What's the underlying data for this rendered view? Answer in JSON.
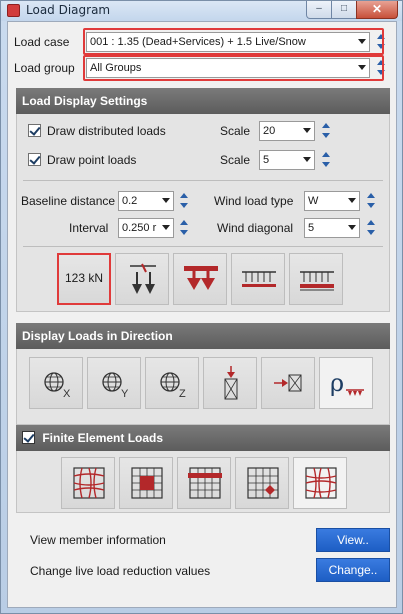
{
  "window": {
    "title": "Load Diagram",
    "controls": {
      "minimize": "–",
      "maximize": "□",
      "close": "✕"
    }
  },
  "load_case": {
    "label": "Load case",
    "value": "001 : 1.35 (Dead+Services) + 1.5 Live/Snow"
  },
  "load_group": {
    "label": "Load group",
    "value": "All Groups"
  },
  "display_settings": {
    "header": "Load Display Settings",
    "draw_distributed": {
      "label": "Draw distributed loads",
      "checked": true
    },
    "draw_point": {
      "label": "Draw point loads",
      "checked": true
    },
    "scale_label_1": "Scale",
    "scale_value_1": "20",
    "scale_label_2": "Scale",
    "scale_value_2": "5",
    "baseline_label": "Baseline distance",
    "baseline_value": "0.2",
    "interval_label": "Interval",
    "interval_value": "0.250 r",
    "wind_type_label": "Wind load type",
    "wind_type_value": "W",
    "wind_diag_label": "Wind diagonal",
    "wind_diag_value": "5",
    "buttons": [
      {
        "name": "show-values",
        "text": "123 kN"
      },
      {
        "name": "point-load-arrows",
        "text": ""
      },
      {
        "name": "udl-arrows",
        "text": ""
      },
      {
        "name": "distributed-line",
        "text": ""
      },
      {
        "name": "distributed-red",
        "text": ""
      }
    ]
  },
  "direction": {
    "header": "Display Loads in Direction",
    "buttons": [
      {
        "name": "global-x",
        "sub": "X"
      },
      {
        "name": "global-y",
        "sub": "Y"
      },
      {
        "name": "global-z",
        "sub": "Z"
      },
      {
        "name": "member-local-y"
      },
      {
        "name": "member-local-x"
      },
      {
        "name": "pressure-load"
      }
    ]
  },
  "fe_loads": {
    "header": "Finite Element Loads",
    "checked": true
  },
  "footer": {
    "member_info_label": "View member information",
    "member_info_button": "View..",
    "reduction_label": "Change live load reduction values",
    "reduction_button": "Change.."
  },
  "colors": {
    "accent_red": "#e03a3a",
    "icon_red": "#b3282a",
    "button_blue": "#2a6ad4",
    "section_gray": "#666666"
  }
}
